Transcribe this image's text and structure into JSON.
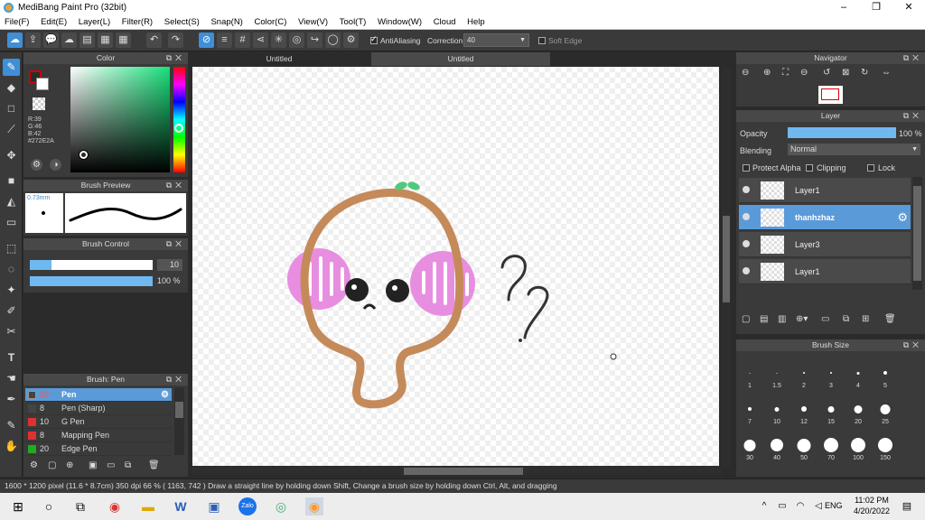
{
  "window": {
    "title": "MediBang Paint Pro (32bit)",
    "controls": [
      "–",
      "❐",
      "✕"
    ]
  },
  "menu": [
    "File(F)",
    "Edit(E)",
    "Layer(L)",
    "Filter(R)",
    "Select(S)",
    "Snap(N)",
    "Color(C)",
    "View(V)",
    "Tool(T)",
    "Window(W)",
    "Cloud",
    "Help"
  ],
  "toolbar": {
    "antialiasing_label": "AntiAliasing",
    "antialiasing_checked": true,
    "correction_label": "Correction",
    "correction_value": "40",
    "soft_edge_label": "Soft Edge",
    "soft_edge_checked": false
  },
  "color_panel": {
    "title": "Color",
    "r": "R:39",
    "g": "G:46",
    "b": "B:42",
    "hex": "#272E2A",
    "foreground": "#272E2A",
    "swatch_border": "#cc0000"
  },
  "brush_preview": {
    "title": "Brush Preview",
    "size": "0.73mm"
  },
  "brush_control": {
    "title": "Brush Control",
    "size_value": "10",
    "size_fraction": 0.18,
    "opacity_value": "100 %",
    "opacity_fraction": 1.0
  },
  "brush_list": {
    "title": "Brush: Pen",
    "items": [
      {
        "size": "10",
        "name": "Pen",
        "color": "#444444",
        "selected": true
      },
      {
        "size": "8",
        "name": "Pen (Sharp)",
        "color": "#444444",
        "selected": false
      },
      {
        "size": "10",
        "name": "G Pen",
        "color": "#e03030",
        "selected": false
      },
      {
        "size": "8",
        "name": "Mapping Pen",
        "color": "#e03030",
        "selected": false
      },
      {
        "size": "20",
        "name": "Edge Pen",
        "color": "#22aa22",
        "selected": false
      }
    ]
  },
  "canvas": {
    "tabs": [
      "Untitled",
      "Untitled"
    ],
    "active_tab": 1
  },
  "navigator": {
    "title": "Navigator"
  },
  "layer_panel": {
    "title": "Layer",
    "opacity_label": "Opacity",
    "opacity_value": "100 %",
    "blending_label": "Blending",
    "blending_value": "Normal",
    "protect_alpha_label": "Protect Alpha",
    "clipping_label": "Clipping",
    "lock_label": "Lock",
    "layers": [
      {
        "name": "Layer1",
        "selected": false
      },
      {
        "name": "thanhzhaz",
        "selected": true
      },
      {
        "name": "Layer3",
        "selected": false
      },
      {
        "name": "Layer1",
        "selected": false
      }
    ]
  },
  "brush_size": {
    "title": "Brush Size",
    "sizes": [
      "1",
      "1.5",
      "2",
      "3",
      "4",
      "5",
      "7",
      "10",
      "12",
      "15",
      "20",
      "25",
      "30",
      "40",
      "50",
      "70",
      "100",
      "150"
    ]
  },
  "status": {
    "text": "1600 * 1200 pixel  (11.6 * 8.7cm)  350 dpi  66 %  ( 1163, 742 )  Draw a straight line by holding down Shift, Change a brush size by holding down Ctrl, Alt, and dragging"
  },
  "taskbar": {
    "lang": "ENG",
    "time": "11:02 PM",
    "date": "4/20/2022"
  }
}
